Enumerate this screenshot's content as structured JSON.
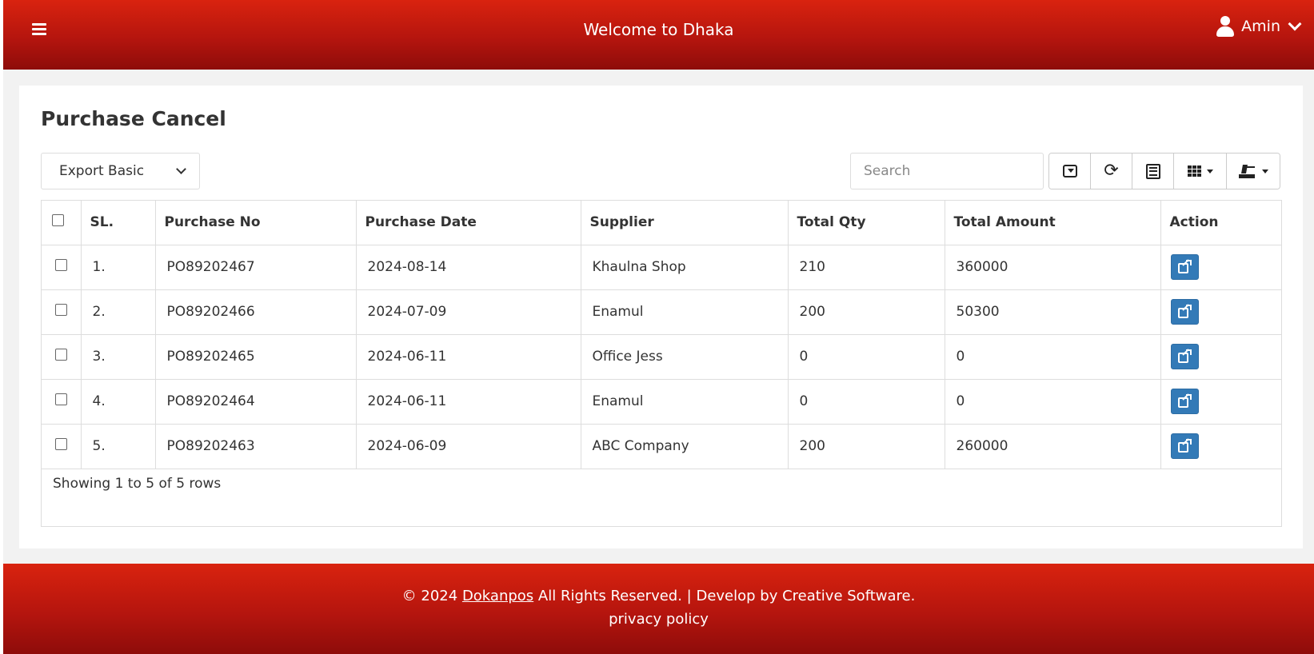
{
  "header": {
    "menu_icon": "hamburger-icon",
    "welcome_text": "Welcome to Dhaka",
    "user_name": "Amin",
    "user_icon": "user-icon",
    "accent_color": "#c8190e"
  },
  "page": {
    "title": "Purchase Cancel"
  },
  "toolbar": {
    "export_select_value": "Export Basic",
    "search_placeholder": "Search",
    "buttons": [
      {
        "name": "toggle-view",
        "icon": "toggle-icon"
      },
      {
        "name": "refresh",
        "icon": "refresh-icon"
      },
      {
        "name": "card-view",
        "icon": "list-icon"
      },
      {
        "name": "columns",
        "icon": "columns-grid-icon"
      },
      {
        "name": "export",
        "icon": "export-icon"
      }
    ]
  },
  "table": {
    "columns": [
      "SL.",
      "Purchase No",
      "Purchase Date",
      "Supplier",
      "Total Qty",
      "Total Amount",
      "Action"
    ],
    "rows": [
      {
        "sl": "1.",
        "purchase_no": "PO89202467",
        "purchase_date": "2024-08-14",
        "supplier": "Khaulna Shop",
        "total_qty": "210",
        "total_amount": "360000"
      },
      {
        "sl": "2.",
        "purchase_no": "PO89202466",
        "purchase_date": "2024-07-09",
        "supplier": "Enamul",
        "total_qty": "200",
        "total_amount": "50300"
      },
      {
        "sl": "3.",
        "purchase_no": "PO89202465",
        "purchase_date": "2024-06-11",
        "supplier": "Office Jess",
        "total_qty": "0",
        "total_amount": "0"
      },
      {
        "sl": "4.",
        "purchase_no": "PO89202464",
        "purchase_date": "2024-06-11",
        "supplier": "Enamul",
        "total_qty": "0",
        "total_amount": "0"
      },
      {
        "sl": "5.",
        "purchase_no": "PO89202463",
        "purchase_date": "2024-06-09",
        "supplier": "ABC Company",
        "total_qty": "200",
        "total_amount": "260000"
      }
    ],
    "action_icon": "external-link-icon",
    "action_color": "#337ab7",
    "pagination_info": "Showing 1 to 5 of 5 rows"
  },
  "footer": {
    "copyright_prefix": "© 2024 ",
    "brand_link": "Dokanpos",
    "copyright_suffix": " All Rights Reserved. | Develop by  Creative Software.",
    "privacy_link": "privacy policy"
  }
}
